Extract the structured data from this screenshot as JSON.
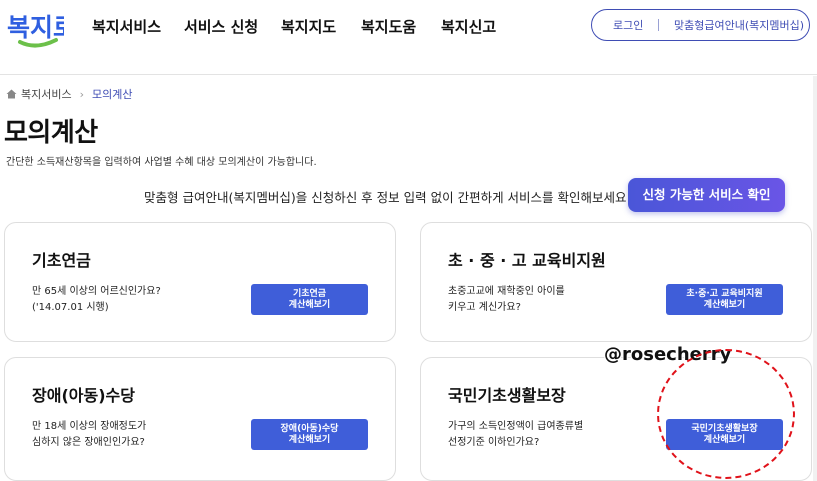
{
  "brand": {
    "logo_text": "복지로",
    "colors": {
      "blue": "#2f5fe0",
      "green": "#6cc04a",
      "accent": "#3f4db4",
      "button": "#3f5ed9",
      "circle": "#e0121a"
    }
  },
  "nav": {
    "items": [
      "복지서비스",
      "서비스 신청",
      "복지지도",
      "복지도움",
      "복지신고"
    ]
  },
  "top_actions": {
    "login": "로그인",
    "membership": "맞춤형급여안내(복지멤버십)"
  },
  "breadcrumb": {
    "home": "복지서비스",
    "current": "모의계산"
  },
  "page": {
    "title": "모의계산",
    "description": "간단한 소득재산항목을 입력하여 사업별 수혜 대상 모의계산이 가능합니다."
  },
  "promo": {
    "text": "맞춤형 급여안내(복지멤버십)을 신청하신 후 정보 입력 없이 간편하게 서비스를 확인해보세요!",
    "button": "신청 가능한 서비스 확인"
  },
  "cards": [
    {
      "title": "기초연금",
      "desc": "만 65세 이상의 어르신인가요?\n('14.07.01 시행)",
      "btn1": "기초연금",
      "btn2": "계산해보기"
    },
    {
      "title": "초 · 중 · 고 교육비지원",
      "desc": "초중고교에 재학중인 아이를\n키우고 계신가요?",
      "btn1": "초·중·고 교육비지원",
      "btn2": "계산해보기"
    },
    {
      "title": "장애(아동)수당",
      "desc": "만 18세 이상의 장애정도가\n심하지 않은 장애인인가요?",
      "btn1": "장애(아동)수당",
      "btn2": "계산해보기"
    },
    {
      "title": "국민기초생활보장",
      "desc": "가구의 소득인정액이 급여종류별\n선정기준 이하인가요?",
      "btn1": "국민기초생활보장",
      "btn2": "계산해보기"
    }
  ],
  "watermark": "@rosecherry"
}
